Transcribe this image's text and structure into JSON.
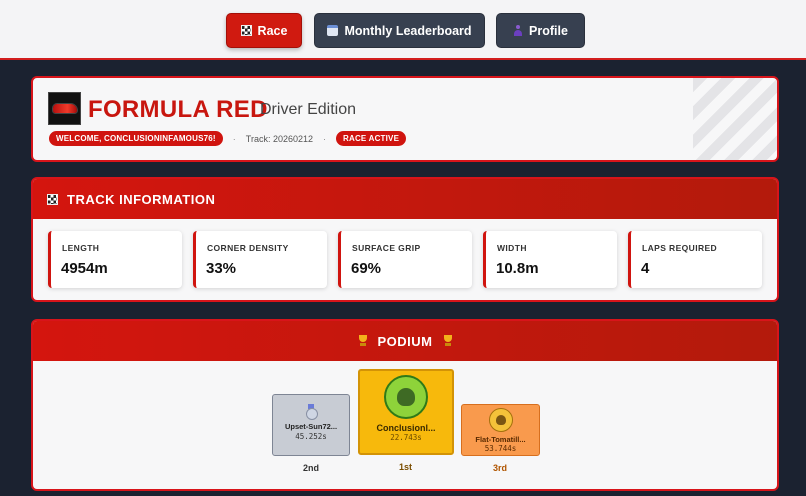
{
  "nav": {
    "race_label": "Race",
    "leaderboard_label": "Monthly Leaderboard",
    "profile_label": "Profile"
  },
  "header": {
    "title": "FORMULA RED",
    "subtitle": "Driver Edition",
    "welcome": "WELCOME, CONCLUSIONINFAMOUS76!",
    "separator": "·",
    "track": "Track: 20260212",
    "status": "RACE ACTIVE"
  },
  "track_info": {
    "heading": "TRACK INFORMATION",
    "stats": [
      {
        "label": "LENGTH",
        "value": "4954m"
      },
      {
        "label": "CORNER DENSITY",
        "value": "33%"
      },
      {
        "label": "SURFACE GRIP",
        "value": "69%"
      },
      {
        "label": "WIDTH",
        "value": "10.8m"
      },
      {
        "label": "LAPS REQUIRED",
        "value": "4"
      }
    ]
  },
  "podium": {
    "heading": "PODIUM",
    "first": {
      "name": "Conclusionl...",
      "time": "22.743s",
      "place": "1st"
    },
    "second": {
      "name": "Upset-Sun72...",
      "time": "45.252s",
      "place": "2nd"
    },
    "third": {
      "name": "Flat-Tomatill...",
      "time": "53.744s",
      "place": "3rd"
    }
  },
  "colors": {
    "accent": "#d0140f",
    "nav_dark": "#374050",
    "gold": "#f7b90c",
    "silver": "#c8ccd4",
    "bronze": "#f99a4d"
  }
}
